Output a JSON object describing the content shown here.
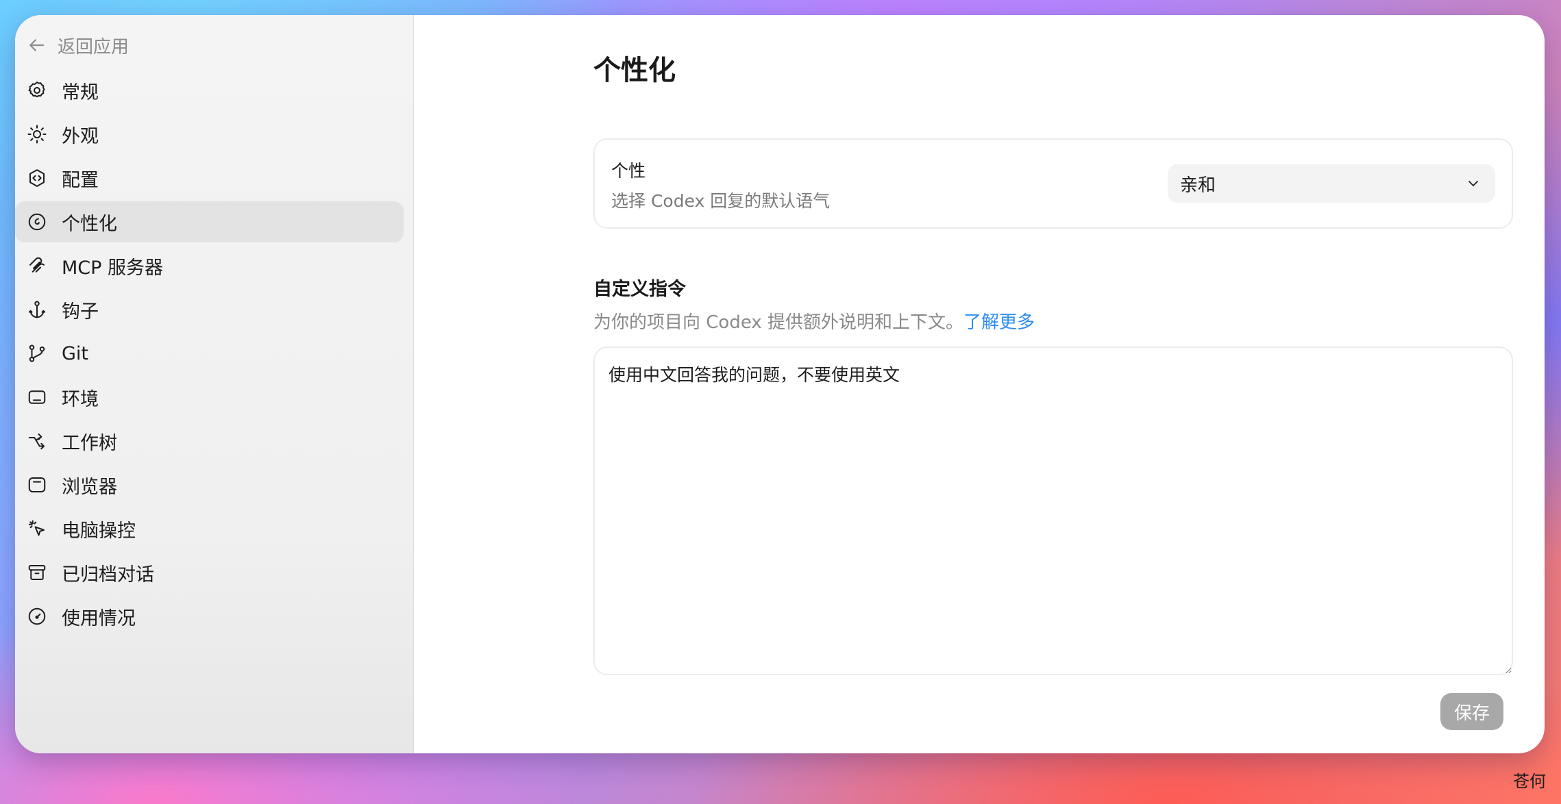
{
  "sidebar": {
    "back_label": "返回应用",
    "items": [
      {
        "label": "常规",
        "icon": "gear-icon",
        "active": false
      },
      {
        "label": "外观",
        "icon": "sun-icon",
        "active": false
      },
      {
        "label": "配置",
        "icon": "code-shield-icon",
        "active": false
      },
      {
        "label": "个性化",
        "icon": "personality-icon",
        "active": true
      },
      {
        "label": "MCP 服务器",
        "icon": "mcp-icon",
        "active": false
      },
      {
        "label": "钩子",
        "icon": "anchor-icon",
        "active": false
      },
      {
        "label": "Git",
        "icon": "git-branch-icon",
        "active": false
      },
      {
        "label": "环境",
        "icon": "environment-icon",
        "active": false
      },
      {
        "label": "工作树",
        "icon": "worktree-icon",
        "active": false
      },
      {
        "label": "浏览器",
        "icon": "browser-icon",
        "active": false
      },
      {
        "label": "电脑操控",
        "icon": "cursor-click-icon",
        "active": false
      },
      {
        "label": "已归档对话",
        "icon": "archive-icon",
        "active": false
      },
      {
        "label": "使用情况",
        "icon": "gauge-icon",
        "active": false
      }
    ]
  },
  "main": {
    "title": "个性化",
    "personality": {
      "title": "个性",
      "description": "选择 Codex 回复的默认语气",
      "selected": "亲和"
    },
    "custom_instructions": {
      "title": "自定义指令",
      "description": "为你的项目向 Codex 提供额外说明和上下文。",
      "link": "了解更多",
      "value": "使用中文回答我的问题，不要使用英文"
    },
    "save_label": "保存"
  },
  "watermark": "苍何",
  "colors": {
    "link": "#2f8ef0",
    "save_disabled": "#a8a8a8",
    "active_item": "#e3e3e3"
  }
}
